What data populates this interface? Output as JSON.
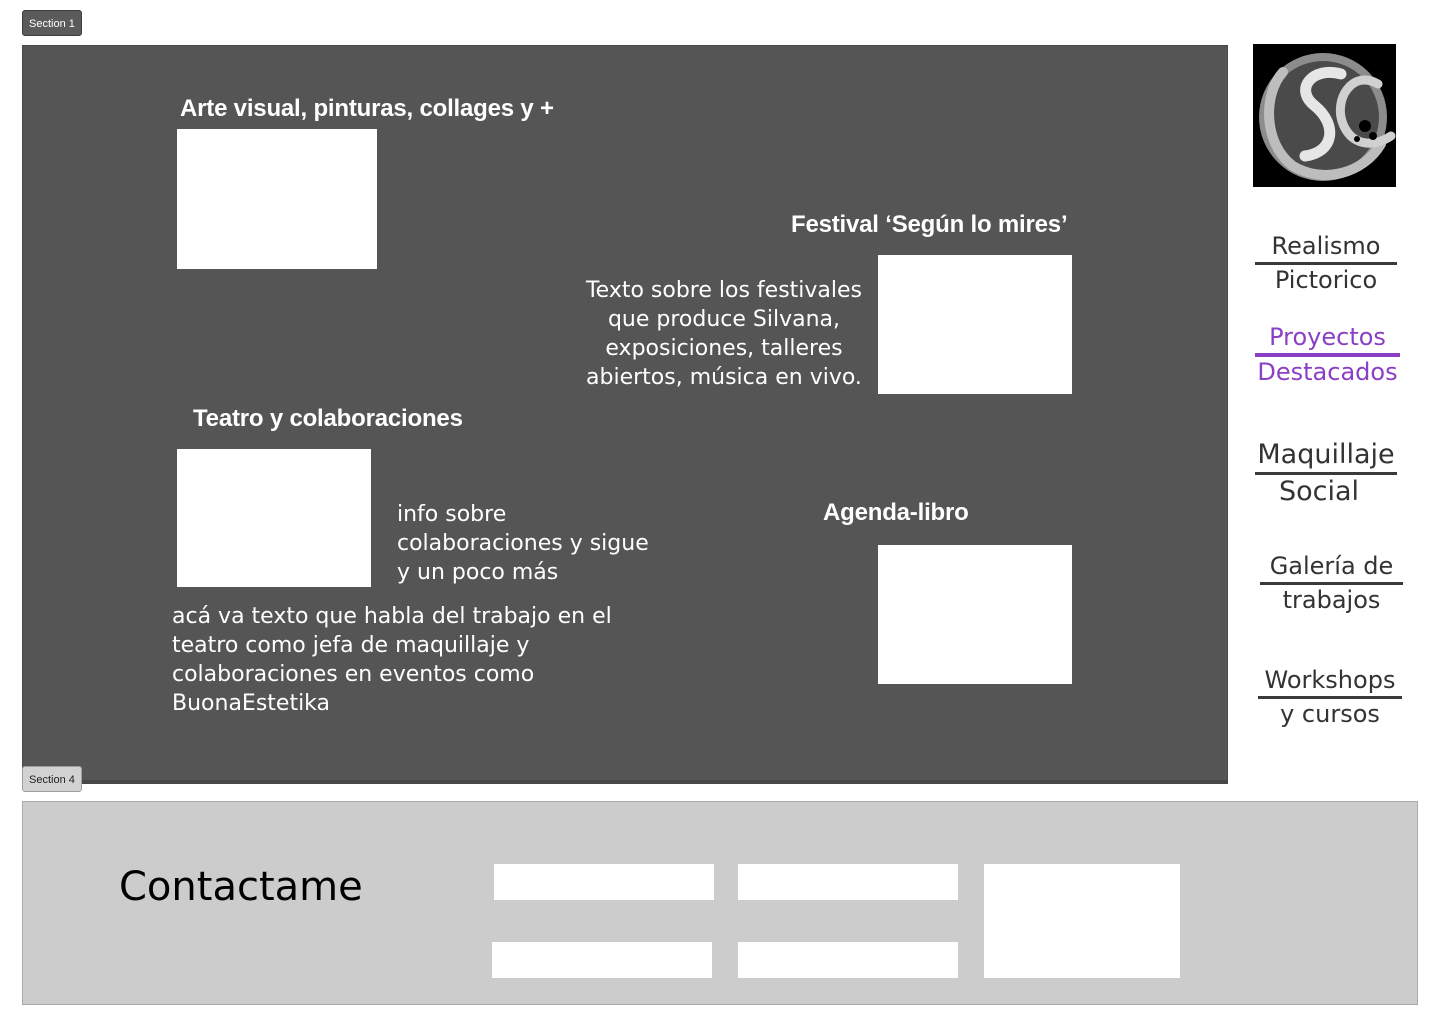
{
  "section_tags": {
    "section1": "Section 1",
    "section4": "Section 4"
  },
  "projects": {
    "arte": {
      "title": "Arte visual, pinturas, collages y +"
    },
    "festival": {
      "title": "Festival ‘Según lo mires’",
      "text_lines": [
        "Texto sobre los festivales",
        "que produce Silvana,",
        "exposiciones, talleres",
        "abiertos, música en vivo."
      ]
    },
    "teatro": {
      "title": "Teatro y colaboraciones",
      "side_lines": [
        "info sobre",
        "colaboraciones y sigue",
        "y un poco más"
      ],
      "text_lines": [
        "acá va texto que habla del trabajo en el",
        "teatro como jefa de maquillaje y",
        "colaboraciones en eventos como",
        "BuonaEstetika"
      ]
    },
    "agenda": {
      "title": "Agenda-libro"
    }
  },
  "logo": {
    "icon": "sc-monogram-logo"
  },
  "nav": [
    {
      "line1": "Realismo",
      "line2": "Pictorico",
      "active": false
    },
    {
      "line1": "Proyectos",
      "line2": "Destacados",
      "active": true
    },
    {
      "line1": "Maquillaje",
      "line2": "Social",
      "active": false
    },
    {
      "line1": "Galería de",
      "line2": "trabajos",
      "active": false
    },
    {
      "line1": "Workshops",
      "line2": "y cursos",
      "active": false
    }
  ],
  "contact": {
    "title": "Contactame"
  },
  "colors": {
    "panel": "#555555",
    "accent": "#8a3fc4",
    "footer": "#cccccc"
  }
}
